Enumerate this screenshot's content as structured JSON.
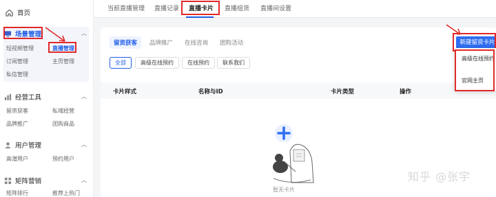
{
  "sidebar": {
    "home": "首页",
    "groups": [
      {
        "title": "场景管理",
        "items": [
          "短视频管理",
          "直播管理",
          "订阅管理",
          "主页管理",
          "私信管理"
        ]
      },
      {
        "title": "经营工具",
        "items": [
          "留资获客",
          "私域经营",
          "品牌推广",
          "团购商品"
        ]
      },
      {
        "title": "用户管理",
        "items": [
          "高潜用户",
          "预约用户"
        ]
      },
      {
        "title": "矩阵营销",
        "items": [
          "矩阵排行",
          "推荐上热门"
        ]
      }
    ]
  },
  "tabs": [
    "当前直播管理",
    "直播记录",
    "直播卡片",
    "直播组货",
    "直播间设置"
  ],
  "main": {
    "subtabs": [
      "留资获客",
      "品牌推广",
      "在线咨询",
      "团购活动"
    ],
    "chips": [
      "全部",
      "高级在线预约",
      "在线预约",
      "联系我们"
    ],
    "new_button": "新建留资卡片",
    "table_headers": [
      "卡片样式",
      "名称与ID",
      "卡片类型",
      "操作"
    ],
    "empty_text": "暂无卡片"
  },
  "dropdown": {
    "items": [
      "高级在线预约",
      "官网主页"
    ]
  },
  "watermark": "知乎 @张宇",
  "colors": {
    "accent": "#1d5ce6",
    "annotation": "#e02828",
    "button": "#2f6ef2"
  }
}
